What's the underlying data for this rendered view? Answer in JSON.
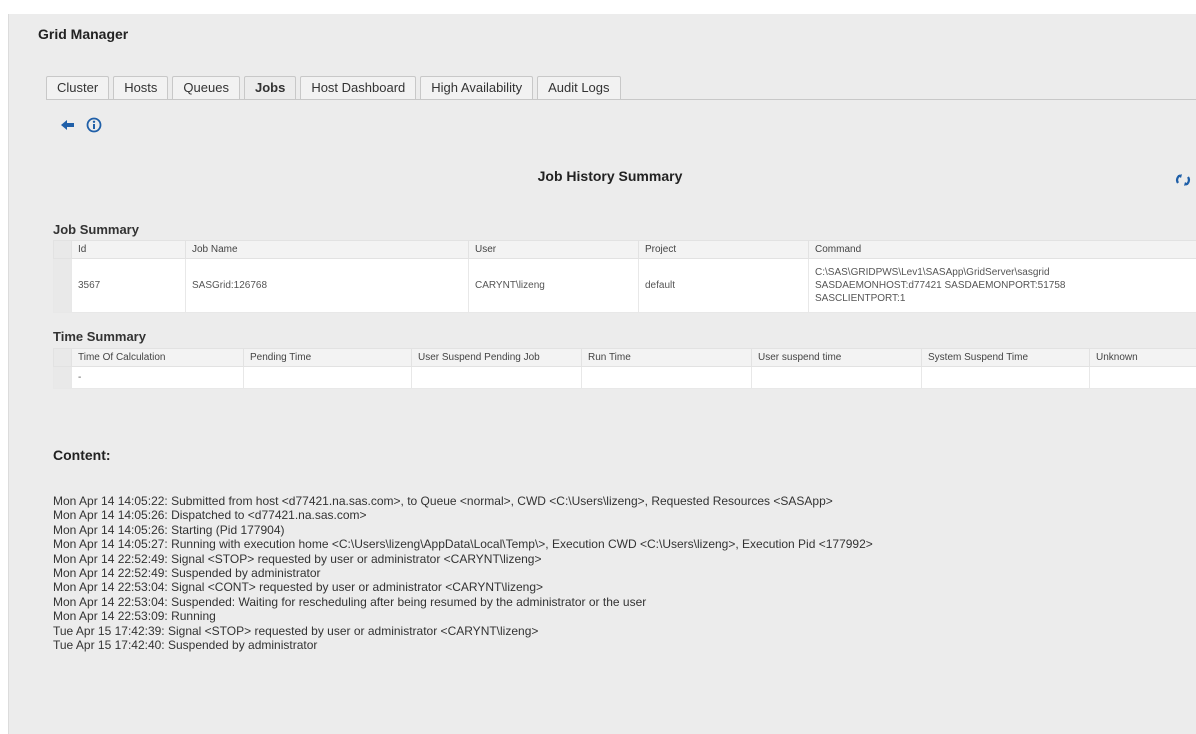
{
  "app": {
    "title": "Grid Manager"
  },
  "tabs": [
    {
      "label": "Cluster"
    },
    {
      "label": "Hosts"
    },
    {
      "label": "Queues"
    },
    {
      "label": "Jobs"
    },
    {
      "label": "Host Dashboard"
    },
    {
      "label": "High Availability"
    },
    {
      "label": "Audit Logs"
    }
  ],
  "active_tab": "Jobs",
  "toolbar": {
    "back_icon": "back-arrow-icon",
    "info_icon": "info-icon",
    "refresh_icon": "refresh-icon"
  },
  "colors": {
    "icon_blue": "#1f5fa8",
    "panel_bg": "#ececec"
  },
  "page": {
    "heading": "Job History Summary"
  },
  "job_summary": {
    "title": "Job Summary",
    "columns": [
      "Id",
      "Job Name",
      "User",
      "Project",
      "Command"
    ],
    "row": {
      "id": "3567",
      "job_name": "SASGrid:126768",
      "user": "CARYNT\\lizeng",
      "project": "default",
      "command_lines": [
        "C:\\SAS\\GRIDPWS\\Lev1\\SASApp\\GridServer\\sasgrid",
        "SASDAEMONHOST:d77421 SASDAEMONPORT:51758",
        "SASCLIENTPORT:1"
      ]
    }
  },
  "time_summary": {
    "title": "Time Summary",
    "columns": [
      "Time Of Calculation",
      "Pending Time",
      "User Suspend Pending Job",
      "Run Time",
      "User suspend time",
      "System Suspend Time",
      "Unknown"
    ],
    "row": [
      "-",
      "",
      "",
      "",
      "",
      "",
      ""
    ]
  },
  "content": {
    "title": "Content:",
    "lines": [
      "Mon Apr 14 14:05:22: Submitted from host <d77421.na.sas.com>, to Queue <normal>, CWD <C:\\Users\\lizeng>, Requested Resources <SASApp>",
      "Mon Apr 14 14:05:26: Dispatched to <d77421.na.sas.com>",
      "Mon Apr 14 14:05:26: Starting (Pid 177904)",
      "Mon Apr 14 14:05:27: Running with execution home <C:\\Users\\lizeng\\AppData\\Local\\Temp\\>, Execution CWD <C:\\Users\\lizeng>, Execution Pid <177992>",
      "Mon Apr 14 22:52:49: Signal <STOP> requested by user or administrator <CARYNT\\lizeng>",
      "Mon Apr 14 22:52:49: Suspended by administrator",
      "Mon Apr 14 22:53:04: Signal <CONT> requested by user or administrator <CARYNT\\lizeng>",
      "Mon Apr 14 22:53:04: Suspended: Waiting for rescheduling after being resumed by the administrator or the user",
      "Mon Apr 14 22:53:09: Running",
      "Tue Apr 15 17:42:39: Signal <STOP> requested by user or administrator <CARYNT\\lizeng>",
      "Tue Apr 15 17:42:40: Suspended by administrator"
    ]
  }
}
